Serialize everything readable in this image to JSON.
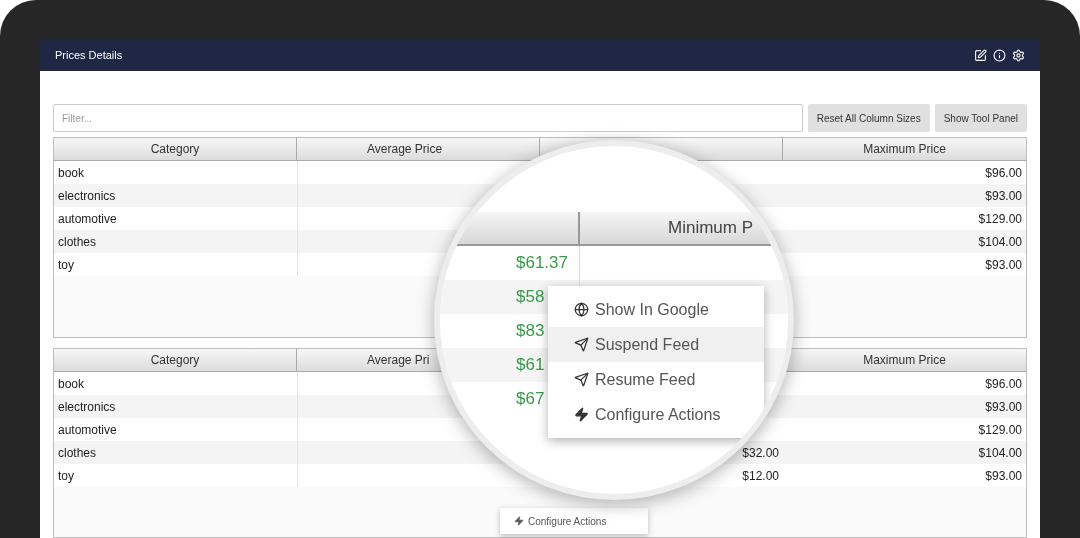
{
  "window": {
    "title": "Prices Details"
  },
  "filter": {
    "placeholder": "Filter..."
  },
  "buttons": [
    "Reset All Column Sizes",
    "Show Tool Panel"
  ],
  "grids": [
    {
      "columns": [
        {
          "label": "Category"
        },
        {
          "label": "Average Price"
        },
        {},
        {
          "label": "Maximum Price"
        }
      ],
      "rows": [
        {
          "category": "book",
          "maximum_price": "$96.00"
        },
        {
          "category": "electronics",
          "maximum_price": "$93.00"
        },
        {
          "category": "automotive",
          "maximum_price": "$129.00"
        },
        {
          "category": "clothes",
          "maximum_price": "$104.00"
        },
        {
          "category": "toy",
          "maximum_price": "$93.00"
        }
      ]
    },
    {
      "columns": [
        {
          "label": "Category"
        },
        {
          "label": "Average Pri"
        },
        {},
        {
          "label": "Maximum Price"
        }
      ],
      "rows": [
        {
          "category": "book",
          "maximum_price": "$96.00"
        },
        {
          "category": "electronics",
          "maximum_price": "$93.00"
        },
        {
          "category": "automotive",
          "maximum_price": "$129.00"
        },
        {
          "category": "clothes",
          "column_3": "$32.00",
          "maximum_price": "$104.00"
        },
        {
          "category": "toy",
          "column_3": "$12.00",
          "maximum_price": "$93.00"
        }
      ]
    }
  ],
  "background_menu": {
    "label": "Configure Actions"
  },
  "magnifier": {
    "header": "Minimum P",
    "values": [
      "$61.37",
      "$58",
      "$83",
      "$61",
      "$67"
    ],
    "menu": [
      {
        "label": "Show In Google",
        "kind": "globe",
        "selected": false
      },
      {
        "label": "Suspend Feed",
        "kind": "send",
        "selected": true
      },
      {
        "label": "Resume Feed",
        "kind": "send",
        "selected": false
      },
      {
        "label": "Configure Actions",
        "kind": "bolt",
        "selected": false
      }
    ]
  }
}
